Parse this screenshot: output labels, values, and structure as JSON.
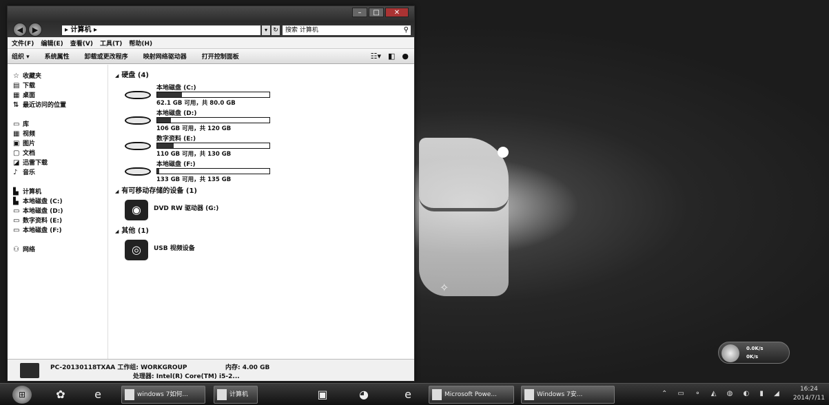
{
  "window": {
    "address_path": "▸ 计算机 ▸",
    "search_placeholder": "搜索 计算机",
    "menu": [
      "文件(F)",
      "编辑(E)",
      "查看(V)",
      "工具(T)",
      "帮助(H)"
    ],
    "toolbar": [
      "组织 ▾",
      "系统属性",
      "卸载或更改程序",
      "映射网络驱动器",
      "打开控制面板"
    ],
    "nav": {
      "favorites": {
        "header": "收藏夹",
        "items": [
          "下载",
          "桌面",
          "最近访问的位置"
        ]
      },
      "libraries": {
        "header": "库",
        "items": [
          "视频",
          "图片",
          "文档",
          "迅雷下载",
          "音乐"
        ]
      },
      "computer": {
        "header": "计算机",
        "items": [
          "本地磁盘 (C:)",
          "本地磁盘 (D:)",
          "数字资料 (E:)",
          "本地磁盘 (F:)"
        ]
      },
      "network": "网络"
    },
    "groups": {
      "hard_disks": {
        "header": "硬盘 (4)",
        "drives": [
          {
            "name": "本地磁盘 (C:)",
            "free": "62.1 GB 可用，共 80.0 GB",
            "used_fraction": 0.22
          },
          {
            "name": "本地磁盘 (D:)",
            "free": "106 GB 可用，共 120 GB",
            "used_fraction": 0.12
          },
          {
            "name": "数字资料 (E:)",
            "free": "110 GB 可用，共 130 GB",
            "used_fraction": 0.15
          },
          {
            "name": "本地磁盘 (F:)",
            "free": "133 GB 可用，共 135 GB",
            "used_fraction": 0.02
          }
        ]
      },
      "removable": {
        "header": "有可移动存储的设备 (1)",
        "device": "DVD RW 驱动器 (G:)"
      },
      "other": {
        "header": "其他 (1)",
        "device": "USB 视频设备"
      }
    },
    "status": {
      "name": "PC-20130118TXAA  工作组: WORKGROUP",
      "memory": "内存: 4.00 GB",
      "cpu": "处理器: Intel(R) Core(TM) i5-2..."
    }
  },
  "taskbar": {
    "tasks": [
      "windows 7如何...",
      "计算机",
      "Microsoft Powe...",
      "Windows 7安..."
    ],
    "clock_time": "16:24",
    "clock_date": "2014/7/11"
  },
  "netmeter": {
    "up": "0.0K/s",
    "down": "0K/s"
  }
}
